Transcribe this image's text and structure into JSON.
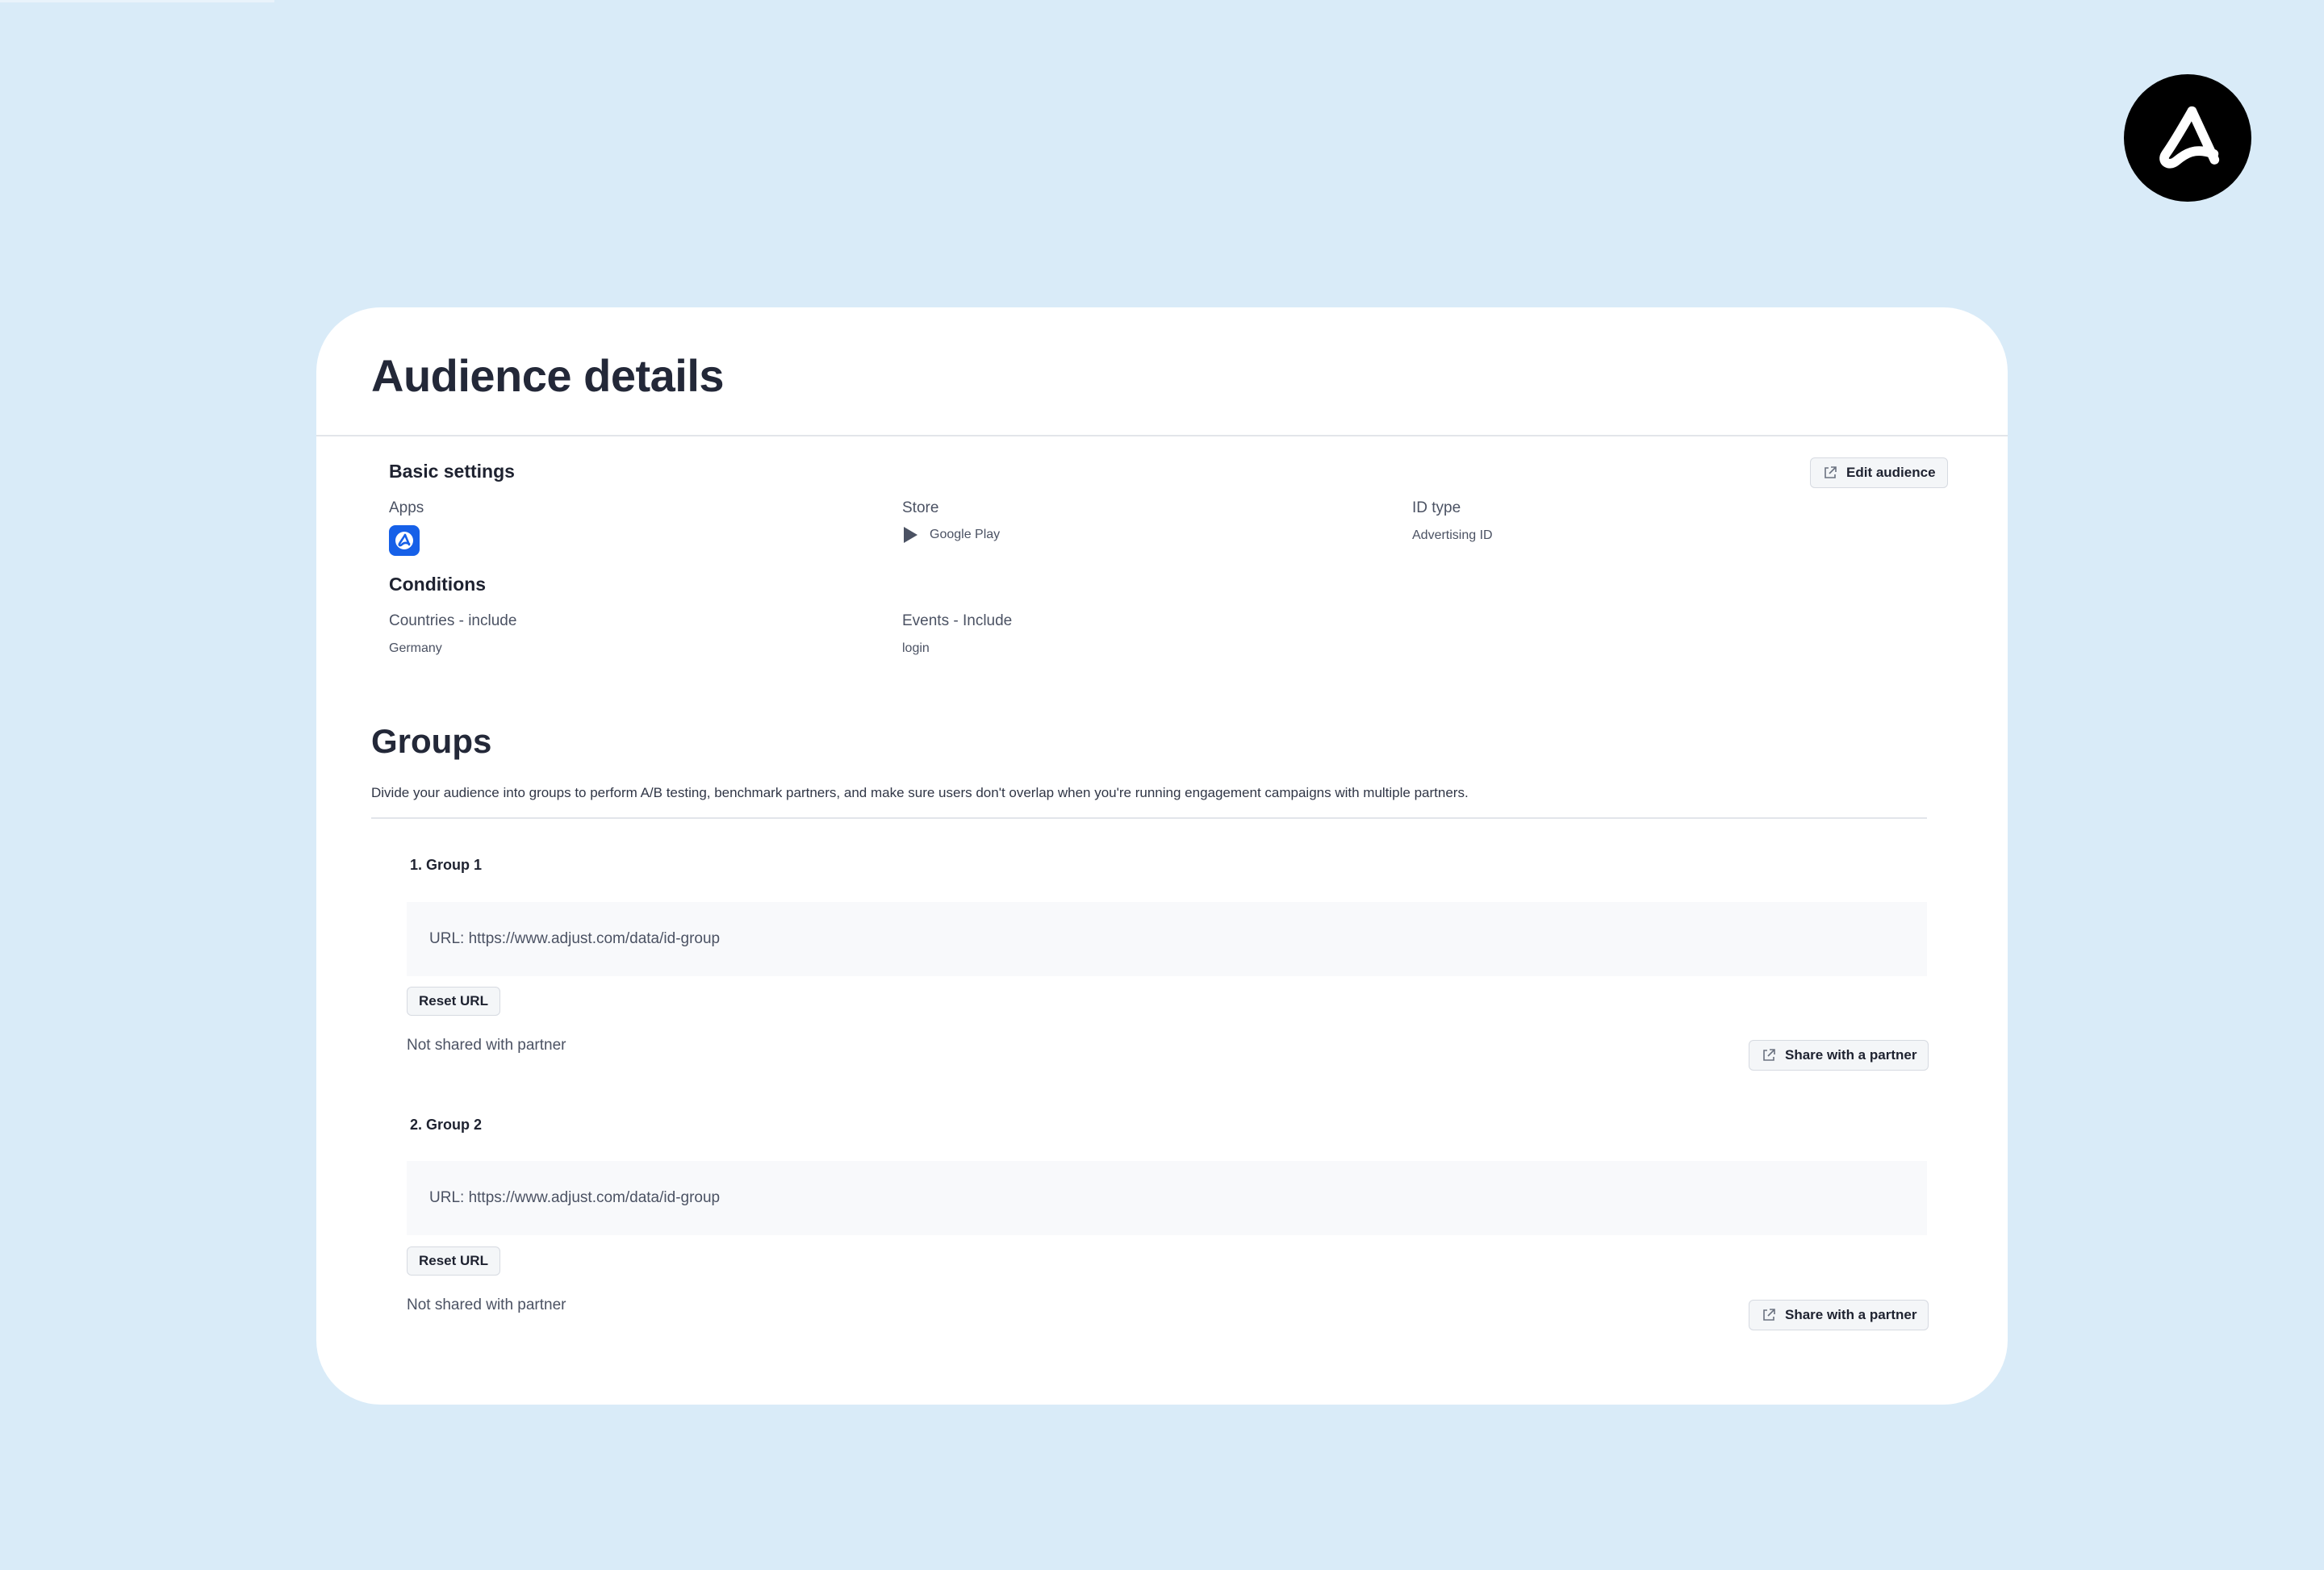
{
  "page": {
    "title": "Audience details"
  },
  "basic_settings": {
    "title": "Basic settings",
    "edit_button_label": "Edit audience",
    "apps_label": "Apps",
    "store_label": "Store",
    "store_value": "Google Play",
    "id_type_label": "ID type",
    "id_type_value": "Advertising ID"
  },
  "conditions": {
    "title": "Conditions",
    "countries_label": "Countries - include",
    "countries_value": "Germany",
    "events_label": "Events - Include",
    "events_value": "login"
  },
  "groups": {
    "title": "Groups",
    "description": "Divide your audience into groups to perform A/B testing, benchmark partners, and make sure users don't overlap when you're running engagement campaigns with multiple partners.",
    "items": [
      {
        "title": "1. Group 1",
        "url_text": "URL: https://www.adjust.com/data/id-group",
        "reset_label": "Reset URL",
        "status": "Not shared with partner",
        "share_label": "Share with a partner"
      },
      {
        "title": "2. Group 2",
        "url_text": "URL: https://www.adjust.com/data/id-group",
        "reset_label": "Reset URL",
        "status": "Not shared with partner",
        "share_label": "Share with a partner"
      }
    ]
  },
  "icons": {
    "brand": "adjust-logo-icon",
    "app": "app-icon",
    "store": "google-play-icon",
    "external": "external-link-icon"
  },
  "colors": {
    "background": "#d9ebf8",
    "card": "#ffffff",
    "accent": "#1660e8",
    "text": "#232838"
  }
}
